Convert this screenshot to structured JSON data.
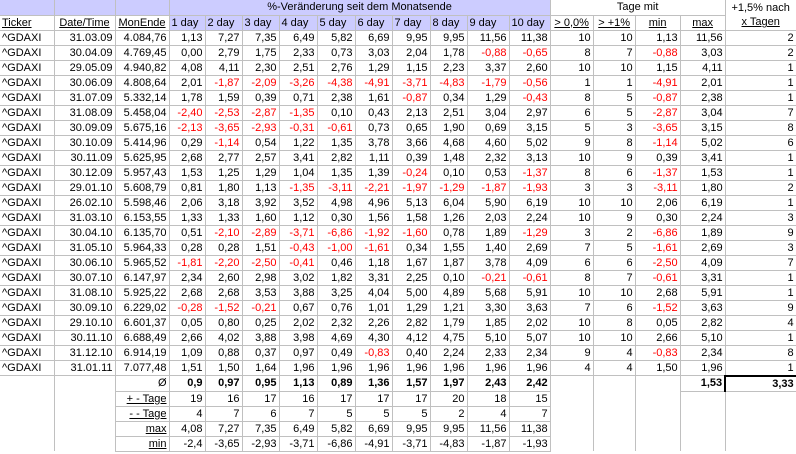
{
  "header": {
    "title": "%-Veränderung seit dem Monatsende",
    "tage_mit": "Tage mit",
    "nach_line1": "+1,5% nach",
    "nach_line2": "x Tagen",
    "columns": [
      "Ticker",
      "Date/Time",
      "MonEnde",
      "1 day",
      "2 day",
      "3 day",
      "4 day",
      "5 day",
      "6 day",
      "7 day",
      "8 day",
      "9 day",
      "10 day",
      "> 0,0%",
      "> +1%",
      "min",
      "max",
      ""
    ]
  },
  "rows": [
    [
      "^GDAXI",
      "31.03.09",
      "4.084,76",
      "1,13",
      "7,27",
      "7,35",
      "6,49",
      "5,82",
      "6,69",
      "9,95",
      "9,95",
      "11,56",
      "11,38",
      "10",
      "10",
      "1,13",
      "11,56",
      "2"
    ],
    [
      "^GDAXI",
      "30.04.09",
      "4.769,45",
      "0,00",
      "2,79",
      "1,75",
      "2,33",
      "0,73",
      "3,03",
      "2,04",
      "1,78",
      "-0,88",
      "-0,65",
      "8",
      "7",
      "-0,88",
      "3,03",
      "2"
    ],
    [
      "^GDAXI",
      "29.05.09",
      "4.940,82",
      "4,08",
      "4,11",
      "2,30",
      "2,51",
      "2,76",
      "1,29",
      "1,15",
      "2,23",
      "3,37",
      "2,60",
      "10",
      "10",
      "1,15",
      "4,11",
      "1"
    ],
    [
      "^GDAXI",
      "30.06.09",
      "4.808,64",
      "2,01",
      "-1,87",
      "-2,09",
      "-3,26",
      "-4,38",
      "-4,91",
      "-3,71",
      "-4,83",
      "-1,79",
      "-0,56",
      "1",
      "1",
      "-4,91",
      "2,01",
      "1"
    ],
    [
      "^GDAXI",
      "31.07.09",
      "5.332,14",
      "1,78",
      "1,59",
      "0,39",
      "0,71",
      "2,38",
      "1,61",
      "-0,87",
      "0,34",
      "1,29",
      "-0,43",
      "8",
      "5",
      "-0,87",
      "2,38",
      "1"
    ],
    [
      "^GDAXI",
      "31.08.09",
      "5.458,04",
      "-2,40",
      "-2,53",
      "-2,87",
      "-1,35",
      "0,10",
      "0,43",
      "2,13",
      "2,51",
      "3,04",
      "2,97",
      "6",
      "5",
      "-2,87",
      "3,04",
      "7"
    ],
    [
      "^GDAXI",
      "30.09.09",
      "5.675,16",
      "-2,13",
      "-3,65",
      "-2,93",
      "-0,31",
      "-0,61",
      "0,73",
      "0,65",
      "1,90",
      "0,69",
      "3,15",
      "5",
      "3",
      "-3,65",
      "3,15",
      "8"
    ],
    [
      "^GDAXI",
      "30.10.09",
      "5.414,96",
      "0,29",
      "-1,14",
      "0,54",
      "1,22",
      "1,35",
      "3,78",
      "3,66",
      "4,68",
      "4,60",
      "5,02",
      "9",
      "8",
      "-1,14",
      "5,02",
      "6"
    ],
    [
      "^GDAXI",
      "30.11.09",
      "5.625,95",
      "2,68",
      "2,77",
      "2,57",
      "3,41",
      "2,82",
      "1,11",
      "0,39",
      "1,48",
      "2,32",
      "3,13",
      "10",
      "9",
      "0,39",
      "3,41",
      "1"
    ],
    [
      "^GDAXI",
      "30.12.09",
      "5.957,43",
      "1,53",
      "1,25",
      "1,29",
      "1,04",
      "1,35",
      "1,39",
      "-0,24",
      "0,10",
      "0,53",
      "-1,37",
      "8",
      "6",
      "-1,37",
      "1,53",
      "1"
    ],
    [
      "^GDAXI",
      "29.01.10",
      "5.608,79",
      "0,81",
      "1,80",
      "1,13",
      "-1,35",
      "-3,11",
      "-2,21",
      "-1,97",
      "-1,29",
      "-1,87",
      "-1,93",
      "3",
      "3",
      "-3,11",
      "1,80",
      "2"
    ],
    [
      "^GDAXI",
      "26.02.10",
      "5.598,46",
      "2,06",
      "3,18",
      "3,92",
      "3,52",
      "4,98",
      "4,96",
      "5,13",
      "6,04",
      "5,90",
      "6,19",
      "10",
      "10",
      "2,06",
      "6,19",
      "1"
    ],
    [
      "^GDAXI",
      "31.03.10",
      "6.153,55",
      "1,33",
      "1,33",
      "1,60",
      "1,12",
      "0,30",
      "1,56",
      "1,58",
      "1,26",
      "2,03",
      "2,24",
      "10",
      "9",
      "0,30",
      "2,24",
      "3"
    ],
    [
      "^GDAXI",
      "30.04.10",
      "6.135,70",
      "0,51",
      "-2,10",
      "-2,89",
      "-3,71",
      "-6,86",
      "-1,92",
      "-1,60",
      "0,78",
      "1,89",
      "-1,29",
      "3",
      "2",
      "-6,86",
      "1,89",
      "9"
    ],
    [
      "^GDAXI",
      "31.05.10",
      "5.964,33",
      "0,28",
      "0,28",
      "1,51",
      "-0,43",
      "-1,00",
      "-1,61",
      "0,34",
      "1,55",
      "1,40",
      "2,69",
      "7",
      "5",
      "-1,61",
      "2,69",
      "3"
    ],
    [
      "^GDAXI",
      "30.06.10",
      "5.965,52",
      "-1,81",
      "-2,20",
      "-2,50",
      "-0,41",
      "0,46",
      "1,18",
      "1,67",
      "1,87",
      "3,78",
      "4,09",
      "6",
      "6",
      "-2,50",
      "4,09",
      "7"
    ],
    [
      "^GDAXI",
      "30.07.10",
      "6.147,97",
      "2,34",
      "2,60",
      "2,98",
      "3,02",
      "1,82",
      "3,31",
      "2,25",
      "0,10",
      "-0,21",
      "-0,61",
      "8",
      "7",
      "-0,61",
      "3,31",
      "1"
    ],
    [
      "^GDAXI",
      "31.08.10",
      "5.925,22",
      "2,68",
      "2,68",
      "3,53",
      "3,88",
      "3,25",
      "4,04",
      "5,00",
      "4,89",
      "5,68",
      "5,91",
      "10",
      "10",
      "2,68",
      "5,91",
      "1"
    ],
    [
      "^GDAXI",
      "30.09.10",
      "6.229,02",
      "-0,28",
      "-1,52",
      "-0,21",
      "0,67",
      "0,76",
      "1,01",
      "1,29",
      "1,21",
      "3,30",
      "3,63",
      "7",
      "6",
      "-1,52",
      "3,63",
      "9"
    ],
    [
      "^GDAXI",
      "29.10.10",
      "6.601,37",
      "0,05",
      "0,80",
      "0,25",
      "2,02",
      "2,32",
      "2,26",
      "2,82",
      "1,79",
      "1,85",
      "2,02",
      "10",
      "8",
      "0,05",
      "2,82",
      "4"
    ],
    [
      "^GDAXI",
      "30.11.10",
      "6.688,49",
      "2,66",
      "4,02",
      "3,88",
      "3,98",
      "4,69",
      "4,30",
      "4,12",
      "4,75",
      "5,10",
      "5,07",
      "10",
      "10",
      "2,66",
      "5,10",
      "1"
    ],
    [
      "^GDAXI",
      "31.12.10",
      "6.914,19",
      "1,09",
      "0,88",
      "0,37",
      "0,97",
      "0,49",
      "-0,83",
      "0,40",
      "2,24",
      "2,33",
      "2,34",
      "9",
      "4",
      "-0,83",
      "2,34",
      "8"
    ],
    [
      "^GDAXI",
      "31.01.11",
      "7.077,48",
      "1,51",
      "1,50",
      "1,64",
      "1,96",
      "1,96",
      "1,96",
      "1,96",
      "1,96",
      "1,96",
      "1,96",
      "4",
      "4",
      "1,50",
      "1,96",
      "1"
    ]
  ],
  "summary": {
    "avg_label": "Ø",
    "avg": [
      "0,9",
      "0,97",
      "0,95",
      "1,13",
      "0,89",
      "1,36",
      "1,57",
      "1,97",
      "2,43",
      "2,42"
    ],
    "avg_max": "1,53",
    "avg_days": "3,33",
    "plus_label": "+ - Tage",
    "plus": [
      "19",
      "16",
      "17",
      "16",
      "17",
      "17",
      "17",
      "20",
      "18",
      "15"
    ],
    "minus_label": "- - Tage",
    "minus": [
      "4",
      "7",
      "6",
      "7",
      "5",
      "5",
      "5",
      "2",
      "4",
      "7"
    ],
    "max_label": "max",
    "max": [
      "4,08",
      "7,27",
      "7,35",
      "6,49",
      "5,82",
      "6,69",
      "9,95",
      "9,95",
      "11,56",
      "11,38"
    ],
    "min_label": "min",
    "min": [
      "-2,4",
      "-3,65",
      "-2,93",
      "-3,71",
      "-6,86",
      "-4,91",
      "-3,71",
      "-4,83",
      "-1,87",
      "-1,93"
    ]
  },
  "colors": {
    "header_bg": "#ccccff",
    "negative": "#ff0000",
    "grid": "#c0c0c0"
  }
}
